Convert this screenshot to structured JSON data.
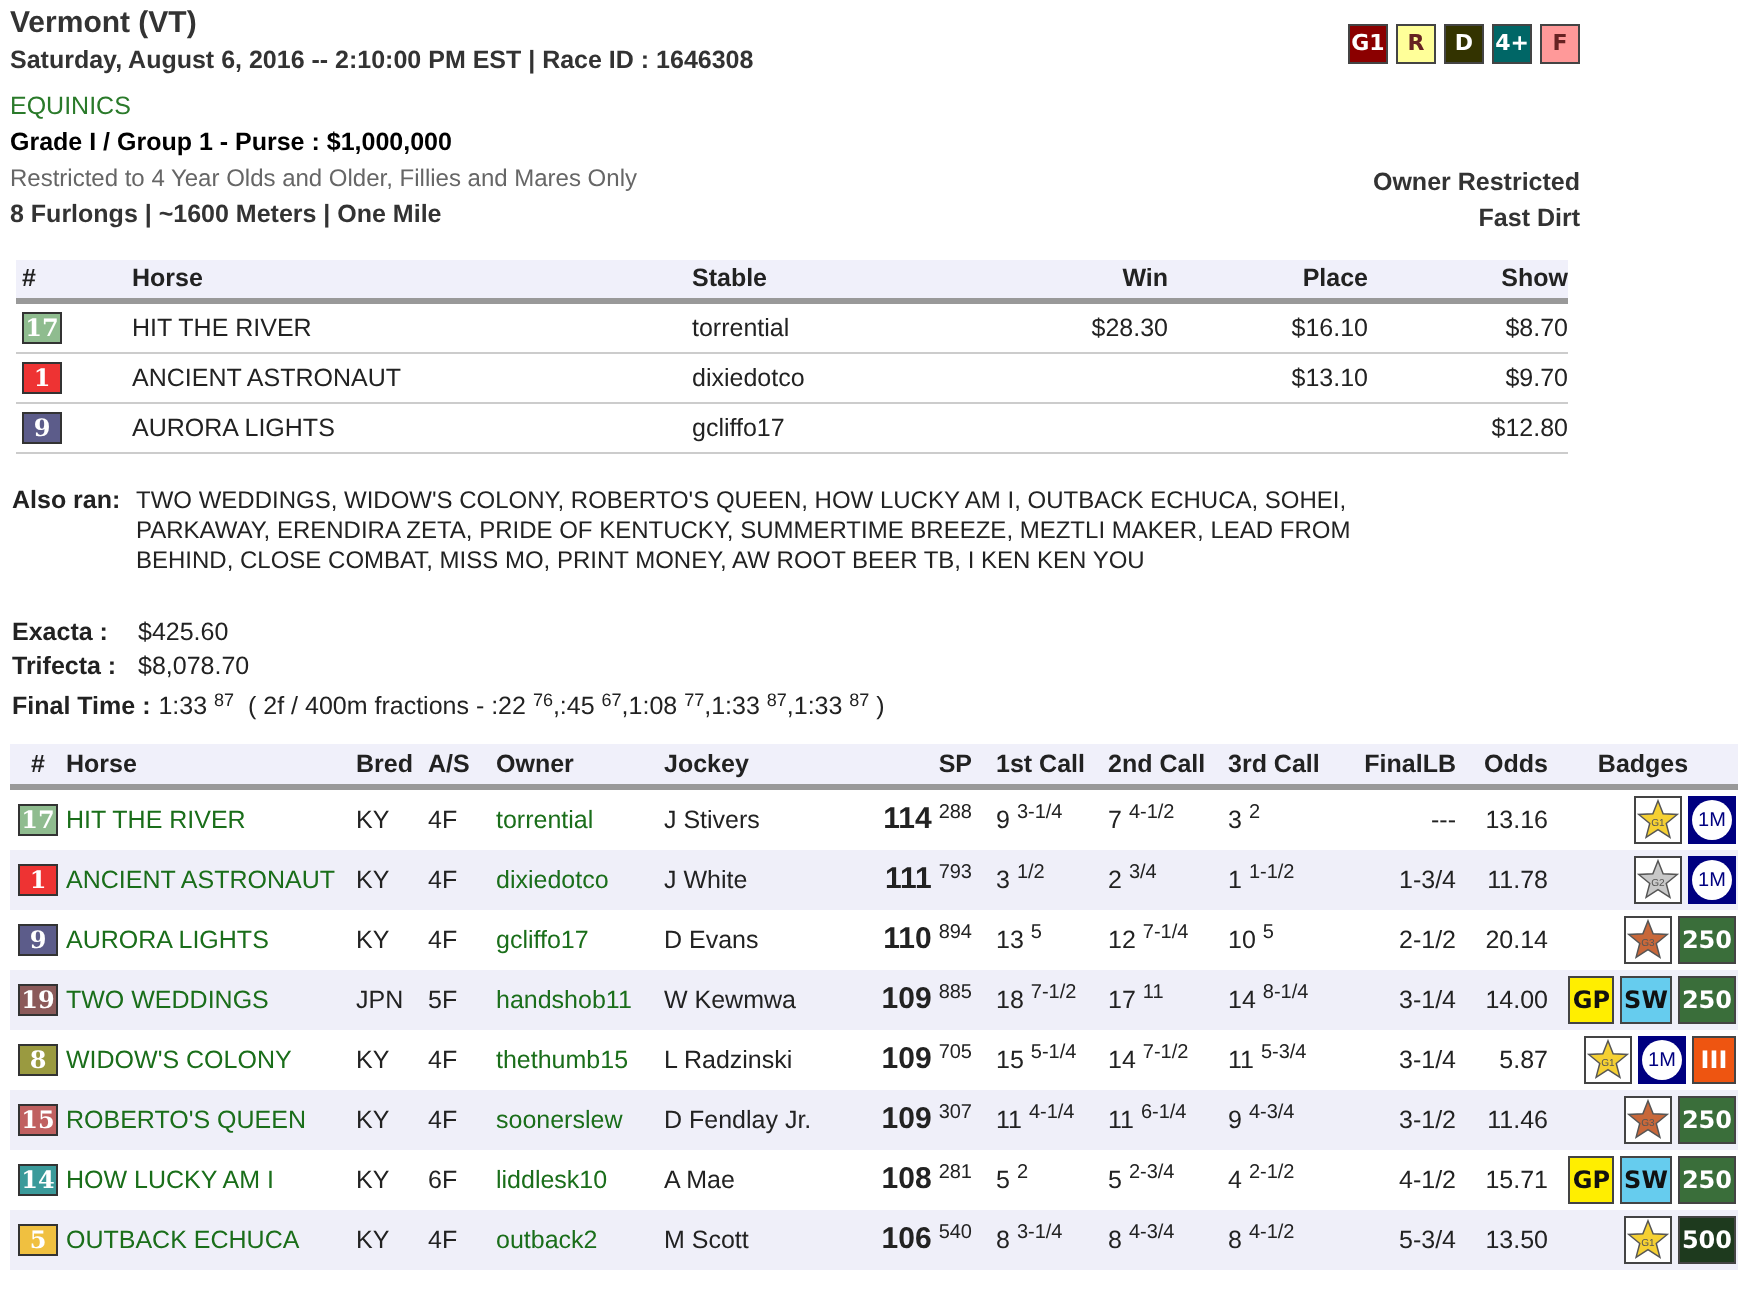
{
  "race": {
    "track": "Vermont (VT)",
    "datetime": "Saturday, August 6, 2016 -- 2:10:00 PM EST | Race ID : 1646308",
    "stable": "EQUINICS",
    "grade": "Grade I / Group 1 - Purse : $1,000,000",
    "restriction": "Restricted to 4 Year Olds and Older, Fillies and Mares Only",
    "distance": "8 Furlongs | ~1600 Meters | One Mile",
    "owner_restriction": "Owner Restricted",
    "surface": "Fast Dirt",
    "tags": [
      {
        "label": "G1",
        "color": "#8b0000"
      },
      {
        "label": "R",
        "color": "#ffff99"
      },
      {
        "label": "D",
        "color": "#333300"
      },
      {
        "label": "4+",
        "color": "#006666"
      },
      {
        "label": "F",
        "color": "#ff9999"
      }
    ]
  },
  "payouts": {
    "columns": [
      "#",
      "Horse",
      "Stable",
      "Win",
      "Place",
      "Show"
    ],
    "rows": [
      {
        "number": "17",
        "color": "#8fbc8f",
        "horse": "HIT THE RIVER",
        "stable": "torrential",
        "win": "$28.30",
        "place": "$16.10",
        "show": "$8.70"
      },
      {
        "number": "1",
        "color": "#ee3333",
        "horse": "ANCIENT ASTRONAUT",
        "stable": "dixiedotco",
        "place": "$13.10",
        "show": "$9.70"
      },
      {
        "number": "9",
        "color": "#5c5c8a",
        "horse": "AURORA LIGHTS",
        "stable": "gcliffo17",
        "show": "$12.80"
      }
    ]
  },
  "also_ran": {
    "label": "Also ran:",
    "text": "TWO WEDDINGS, WIDOW'S COLONY, ROBERTO'S QUEEN, HOW LUCKY AM I, OUTBACK ECHUCA, SOHEI, PARKAWAY, ERENDIRA ZETA, PRIDE OF KENTUCKY, SUMMERTIME BREEZE, MEZTLI MAKER, LEAD FROM BEHIND, CLOSE COMBAT, MISS MO, PRINT MONEY, AW ROOT BEER TB, I KEN KEN YOU"
  },
  "exotics": [
    {
      "label": "Exacta :",
      "value": "$425.60"
    },
    {
      "label": "Trifecta :",
      "value": "$8,078.70"
    }
  ],
  "final_time": {
    "label": "Final Time :",
    "value": "1:33 $^{87}$  ( 2f / 400m fractions - :22 $^{76}$,:45 $^{67}$,1:08 $^{77}$,1:33 $^{87}$,1:33 $^{87}$ )"
  },
  "results": {
    "columns": [
      "#",
      "Horse",
      "Bred",
      "A/S",
      "Owner",
      "Jockey",
      "SP",
      "1st Call",
      "2nd Call",
      "3rd Call",
      "FinalLB",
      "Odds",
      "Badges"
    ],
    "rows": [
      {
        "number": "17",
        "color": "#8fbc8f",
        "horse": "HIT THE RIVER",
        "bred": "KY",
        "as": "4F",
        "owner": "torrential",
        "jockey": "J Stivers",
        "sp": "**114** $^{288}$",
        "call1": "9 $^{3-1/4}$",
        "call2": "7 $^{4-1/2}$",
        "call3": "3 $^{2}$",
        "finallb": "---",
        "odds": "13.16",
        "badges": [
          {
            "kind": "star",
            "label": "G1",
            "color": "#f5d033"
          },
          {
            "kind": "circle",
            "label": "1M",
            "color": "#000080"
          }
        ]
      },
      {
        "number": "1",
        "color": "#ee3333",
        "horse": "ANCIENT ASTRONAUT",
        "bred": "KY",
        "as": "4F",
        "owner": "dixiedotco",
        "jockey": "J White",
        "sp": "**111** $^{793}$",
        "call1": "3 $^{1/2}$",
        "call2": "2 $^{3/4}$",
        "call3": "1 $^{1-1/2}$",
        "finallb": "1-3/4",
        "odds": "11.78",
        "badges": [
          {
            "kind": "star",
            "label": "G2",
            "color": "#c8c8c8"
          },
          {
            "kind": "circle",
            "label": "1M",
            "color": "#000080"
          }
        ]
      },
      {
        "number": "9",
        "color": "#5c5c8a",
        "horse": "AURORA LIGHTS",
        "bred": "KY",
        "as": "4F",
        "owner": "gcliffo17",
        "jockey": "D Evans",
        "sp": "**110** $^{894}$",
        "call1": "13 $^{5}$",
        "call2": "12 $^{7-1/4}$",
        "call3": "10 $^{5}$",
        "finallb": "2-1/2",
        "odds": "20.14",
        "badges": [
          {
            "kind": "star",
            "label": "G3",
            "color": "#c8683a"
          },
          {
            "kind": "square",
            "label": "250",
            "color": "#3a6e3a"
          }
        ]
      },
      {
        "number": "19",
        "color": "#8b5a5a",
        "horse": "TWO WEDDINGS",
        "bred": "JPN",
        "as": "5F",
        "owner": "handshob11",
        "jockey": "W Kewmwa",
        "sp": "**109** $^{885}$",
        "call1": "18 $^{7-1/2}$",
        "call2": "17 $^{11}$",
        "call3": "14 $^{8-1/4}$",
        "finallb": "3-1/4",
        "odds": "14.00",
        "badges": [
          {
            "kind": "square",
            "label": "GP",
            "color": "#ffee00"
          },
          {
            "kind": "square",
            "label": "SW",
            "color": "#66ccee"
          },
          {
            "kind": "square",
            "label": "250",
            "color": "#3a6e3a"
          }
        ]
      },
      {
        "number": "8",
        "color": "#9a9a40",
        "horse": "WIDOW'S COLONY",
        "bred": "KY",
        "as": "4F",
        "owner": "thethumb15",
        "jockey": "L Radzinski",
        "sp": "**109** $^{705}$",
        "call1": "15 $^{5-1/4}$",
        "call2": "14 $^{7-1/2}$",
        "call3": "11 $^{5-3/4}$",
        "finallb": "3-1/4",
        "odds": "5.87",
        "badges": [
          {
            "kind": "star",
            "label": "G1",
            "color": "#f5d033"
          },
          {
            "kind": "circle",
            "label": "1M",
            "color": "#000080"
          },
          {
            "kind": "square",
            "label": "III",
            "color": "#ee5511"
          }
        ]
      },
      {
        "number": "15",
        "color": "#c06060",
        "horse": "ROBERTO'S QUEEN",
        "bred": "KY",
        "as": "4F",
        "owner": "soonerslew",
        "jockey": "D Fendlay Jr.",
        "sp": "**109** $^{307}$",
        "call1": "11 $^{4-1/4}$",
        "call2": "11 $^{6-1/4}$",
        "call3": "9 $^{4-3/4}$",
        "finallb": "3-1/2",
        "odds": "11.46",
        "badges": [
          {
            "kind": "star",
            "label": "G3",
            "color": "#c8683a"
          },
          {
            "kind": "square",
            "label": "250",
            "color": "#3a6e3a"
          }
        ]
      },
      {
        "number": "14",
        "color": "#3a9a9a",
        "horse": "HOW LUCKY AM I",
        "bred": "KY",
        "as": "6F",
        "owner": "liddlesk10",
        "jockey": "A Mae",
        "sp": "**108** $^{281}$",
        "call1": "5 $^{2}$",
        "call2": "5 $^{2-3/4}$",
        "call3": "4 $^{2-1/2}$",
        "finallb": "4-1/2",
        "odds": "15.71",
        "badges": [
          {
            "kind": "square",
            "label": "GP",
            "color": "#ffee00"
          },
          {
            "kind": "square",
            "label": "SW",
            "color": "#66ccee"
          },
          {
            "kind": "square",
            "label": "250",
            "color": "#3a6e3a"
          }
        ]
      },
      {
        "number": "5",
        "color": "#f0c040",
        "horse": "OUTBACK ECHUCA",
        "bred": "KY",
        "as": "4F",
        "owner": "outback2",
        "jockey": "M Scott",
        "sp": "**106** $^{540}$",
        "call1": "8 $^{3-1/4}$",
        "call2": "8 $^{4-3/4}$",
        "call3": "8 $^{4-1/2}$",
        "finallb": "5-3/4",
        "odds": "13.50",
        "badges": [
          {
            "kind": "star",
            "label": "G1",
            "color": "#f5d033"
          },
          {
            "kind": "square",
            "label": "500",
            "color": "#1e3a1e"
          }
        ]
      }
    ]
  }
}
